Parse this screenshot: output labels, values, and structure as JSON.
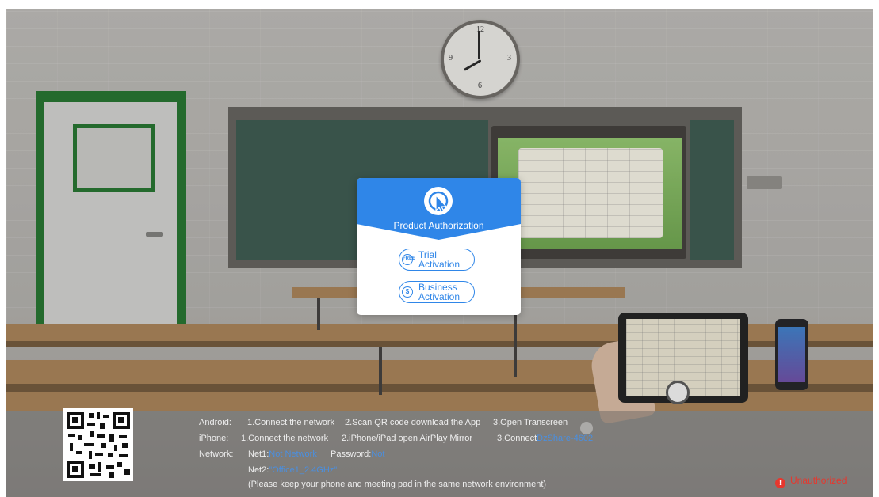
{
  "dialog": {
    "title": "Product Authorization",
    "logo_icon": "cursor-click-logo-icon",
    "trial_button": {
      "label_line1": "Trial",
      "label_line2": "Activation",
      "icon": "free-badge-icon",
      "icon_text": "FREE"
    },
    "business_button": {
      "label_line1": "Business",
      "label_line2": "Activation",
      "icon": "dollar-coin-icon",
      "icon_text": "$"
    }
  },
  "info": {
    "android": {
      "label": "Android:",
      "step1": "1.Connect the network",
      "step2": "2.Scan QR code download the App",
      "step3": "3.Open Transcreen"
    },
    "iphone": {
      "label": "iPhone:",
      "step1": "1.Connect the network",
      "step2": "2.iPhone/iPad open AirPlay Mirror",
      "step3_prefix": "3.Connect",
      "step3_name": "DzShare-4602"
    },
    "network": {
      "label": "Network:",
      "net1_label": "Net1:",
      "net1_value": "Not Network",
      "password_label": "Password:",
      "password_value": "Not",
      "net2_label": "Net2:",
      "net2_value": "\"Office1_2.4GHz\""
    },
    "note": "(Please keep your phone and meeting pad in the same network environment)"
  },
  "status": {
    "text": "Unauthorized",
    "icon": "error-icon",
    "icon_text": "!"
  },
  "colors": {
    "accent": "#2f86e8",
    "highlight": "#4a8fe0",
    "error": "#e6372e"
  }
}
